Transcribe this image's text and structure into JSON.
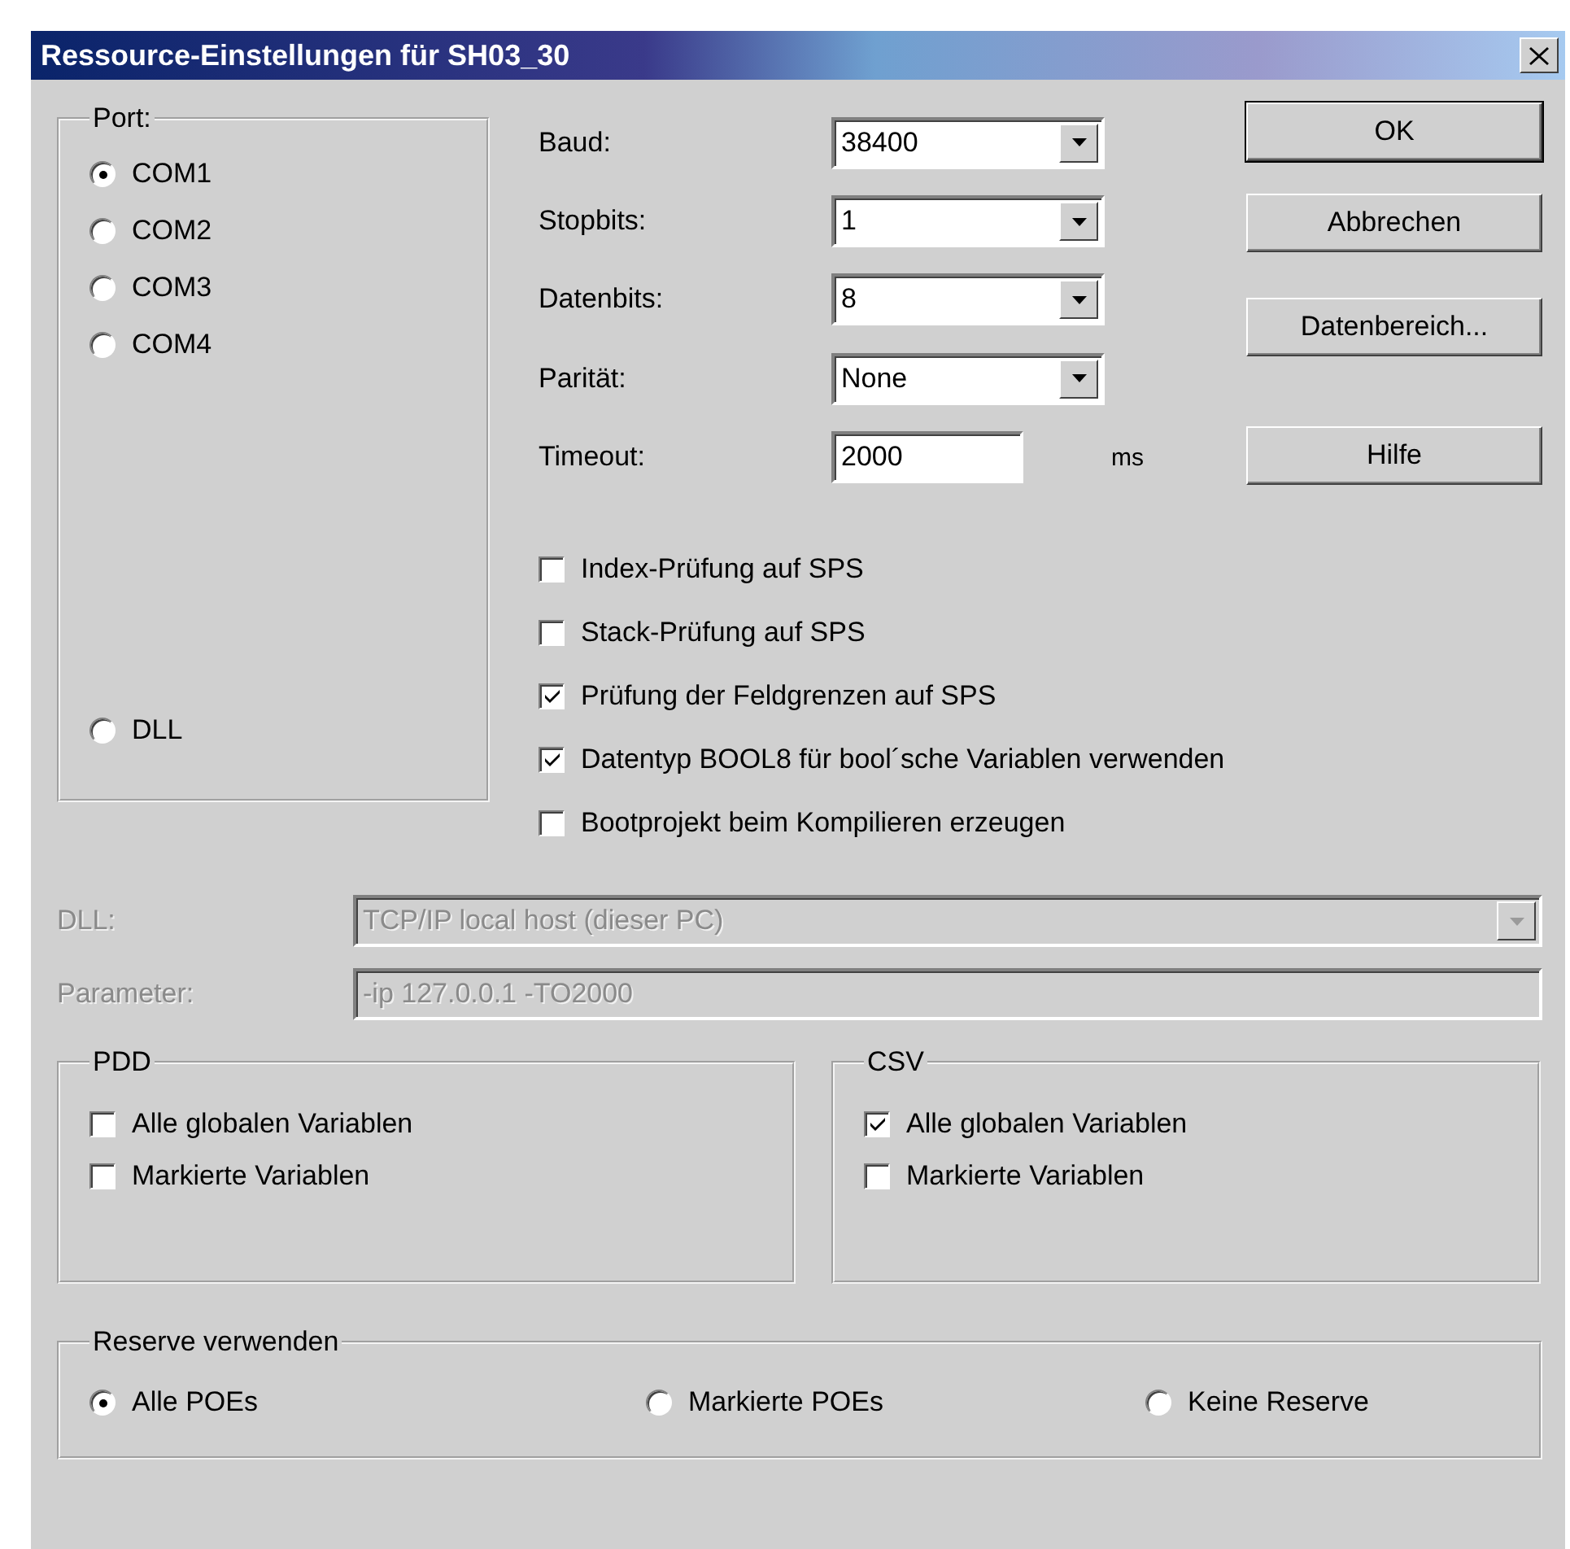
{
  "window": {
    "title": "Ressource-Einstellungen für SH03_30"
  },
  "port": {
    "title": "Port:",
    "options": [
      {
        "label": "COM1",
        "selected": true
      },
      {
        "label": "COM2",
        "selected": false
      },
      {
        "label": "COM3",
        "selected": false
      },
      {
        "label": "COM4",
        "selected": false
      },
      {
        "label": "DLL",
        "selected": false
      }
    ]
  },
  "settings": [
    {
      "kind": "combo",
      "label": "Baud:",
      "value": "38400"
    },
    {
      "kind": "combo",
      "label": "Stopbits:",
      "value": "1"
    },
    {
      "kind": "combo",
      "label": "Datenbits:",
      "value": "8"
    },
    {
      "kind": "combo",
      "label": "Parität:",
      "value": "None"
    },
    {
      "kind": "text",
      "label": "Timeout:",
      "value": "2000",
      "unit": "ms"
    }
  ],
  "buttons": [
    {
      "label": "OK",
      "default": true
    },
    {
      "label": "Abbrechen",
      "default": false
    },
    {
      "label": "Datenbereich...",
      "default": false
    },
    {
      "label": "Hilfe",
      "default": false
    }
  ],
  "checks": [
    {
      "label": "Index-Prüfung auf SPS",
      "checked": false
    },
    {
      "label": "Stack-Prüfung auf SPS",
      "checked": false
    },
    {
      "label": "Prüfung der Feldgrenzen auf SPS",
      "checked": true
    },
    {
      "label": "Datentyp BOOL8 für bool´sche Variablen verwenden",
      "checked": true
    },
    {
      "label": "Bootprojekt beim Kompilieren erzeugen",
      "checked": false
    }
  ],
  "dll": {
    "kind": "combo",
    "label": "DLL:",
    "value": "TCP/IP local host (dieser PC)",
    "disabled": true
  },
  "parameter": {
    "kind": "text",
    "label": "Parameter:",
    "value": "-ip 127.0.0.1 -TO2000",
    "disabled": true
  },
  "pdd": {
    "title": "PDD",
    "items": [
      {
        "label": "Alle globalen Variablen",
        "checked": false
      },
      {
        "label": "Markierte Variablen",
        "checked": false
      }
    ]
  },
  "csv": {
    "title": "CSV",
    "items": [
      {
        "label": "Alle globalen Variablen",
        "checked": true
      },
      {
        "label": "Markierte Variablen",
        "checked": false
      }
    ]
  },
  "reserve": {
    "title": "Reserve verwenden",
    "options": [
      {
        "label": "Alle POEs",
        "selected": true
      },
      {
        "label": "Markierte POEs",
        "selected": false
      },
      {
        "label": "Keine Reserve",
        "selected": false
      }
    ]
  }
}
